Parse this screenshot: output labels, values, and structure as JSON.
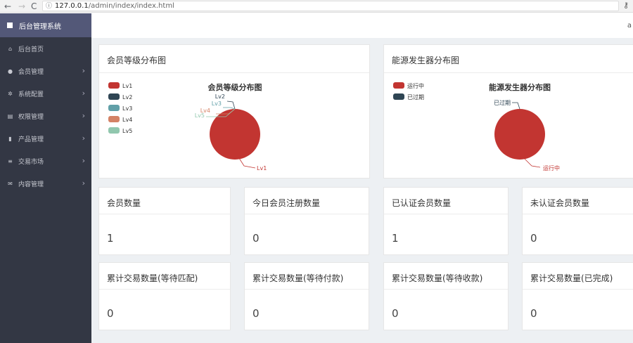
{
  "browser": {
    "url_host": "127.0.0.1",
    "url_path": "/admin/index/index.html",
    "back_glyph": "←",
    "forward_glyph": "→",
    "reload_glyph": "C",
    "info_glyph": "ⓘ",
    "key_glyph": "⚷"
  },
  "sidebar": {
    "title": "后台管理系统",
    "items": [
      {
        "label": "后台首页",
        "icon": "home-icon",
        "glyph": "⌂",
        "has_arrow": false
      },
      {
        "label": "会员管理",
        "icon": "user-icon",
        "glyph": "●",
        "has_arrow": true
      },
      {
        "label": "系统配置",
        "icon": "gears-icon",
        "glyph": "✲",
        "has_arrow": true
      },
      {
        "label": "权限管理",
        "icon": "list-icon",
        "glyph": "▤",
        "has_arrow": true
      },
      {
        "label": "产品管理",
        "icon": "book-icon",
        "glyph": "▮",
        "has_arrow": true
      },
      {
        "label": "交易市场",
        "icon": "bars-icon",
        "glyph": "≡",
        "has_arrow": true
      },
      {
        "label": "内容管理",
        "icon": "envelope-icon",
        "glyph": "✉",
        "has_arrow": true
      }
    ],
    "arrow_glyph": "›"
  },
  "topbar": {
    "user_initial": "a"
  },
  "charts": {
    "member_level": {
      "card_title": "会员等级分布图",
      "chart_title": "会员等级分布图",
      "legend": [
        {
          "label": "Lv1",
          "color": "#c23531"
        },
        {
          "label": "Lv2",
          "color": "#2f4554"
        },
        {
          "label": "Lv3",
          "color": "#61a0a8"
        },
        {
          "label": "Lv4",
          "color": "#d48265"
        },
        {
          "label": "Lv5",
          "color": "#91c7ae"
        }
      ]
    },
    "generator": {
      "card_title": "能源发生器分布图",
      "chart_title": "能源发生器分布图",
      "legend": [
        {
          "label": "运行中",
          "color": "#c23531"
        },
        {
          "label": "已过期",
          "color": "#2f4554"
        }
      ]
    }
  },
  "chart_data": [
    {
      "type": "pie",
      "title": "会员等级分布图",
      "categories": [
        "Lv1",
        "Lv2",
        "Lv3",
        "Lv4",
        "Lv5"
      ],
      "values": [
        1,
        0,
        0,
        0,
        0
      ],
      "colors": [
        "#c23531",
        "#2f4554",
        "#61a0a8",
        "#d48265",
        "#91c7ae"
      ],
      "legend_position": "top-left"
    },
    {
      "type": "pie",
      "title": "能源发生器分布图",
      "categories": [
        "运行中",
        "已过期"
      ],
      "values": [
        1,
        0
      ],
      "colors": [
        "#c23531",
        "#2f4554"
      ],
      "legend_position": "top-left"
    }
  ],
  "stats": [
    {
      "label": "会员数量",
      "value": "1"
    },
    {
      "label": "今日会员注册数量",
      "value": "0"
    },
    {
      "label": "已认证会员数量",
      "value": "1"
    },
    {
      "label": "未认证会员数量",
      "value": "0"
    },
    {
      "label": "累计交易数量(等待匹配)",
      "value": "0"
    },
    {
      "label": "累计交易数量(等待付款)",
      "value": "0"
    },
    {
      "label": "累计交易数量(等待收款)",
      "value": "0"
    },
    {
      "label": "累计交易数量(已完成)",
      "value": "0"
    }
  ]
}
